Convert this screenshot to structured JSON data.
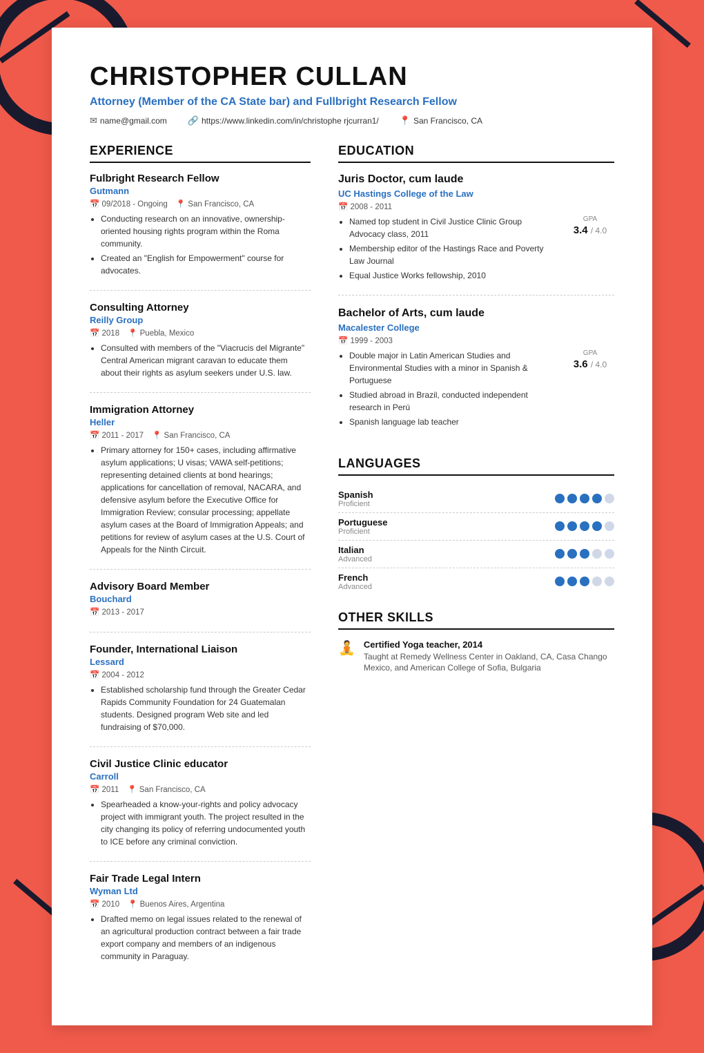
{
  "header": {
    "name": "CHRISTOPHER CULLAN",
    "title": "Attorney (Member of the CA State bar) and Fullbright Research Fellow",
    "contact": {
      "email": "name@gmail.com",
      "linkedin": "https://www.linkedin.com/in/christophe rjcurran1/",
      "location": "San Francisco, CA"
    }
  },
  "experience": {
    "section_title": "EXPERIENCE",
    "items": [
      {
        "title": "Fulbright Research Fellow",
        "company": "Gutmann",
        "date": "09/2018 - Ongoing",
        "location": "San Francisco, CA",
        "bullets": [
          "Conducting research on an innovative, ownership-oriented housing rights program within the Roma community.",
          "Created an \"English for Empowerment\" course for advocates."
        ]
      },
      {
        "title": "Consulting Attorney",
        "company": "Reilly Group",
        "date": "2018",
        "location": "Puebla, Mexico",
        "bullets": [
          "Consulted with members of the \"Viacrucis del Migrante\" Central American migrant caravan to educate them about their rights as asylum seekers under U.S. law."
        ]
      },
      {
        "title": "Immigration Attorney",
        "company": "Heller",
        "date": "2011 - 2017",
        "location": "San Francisco, CA",
        "bullets": [
          "Primary attorney for 150+ cases, including affirmative asylum applications; U visas; VAWA self-petitions; representing detained clients at bond hearings; applications for cancellation of removal, NACARA, and defensive asylum before the Executive Office for Immigration Review; consular processing; appellate asylum cases at the Board of Immigration Appeals; and petitions for review of asylum cases at the U.S. Court of Appeals for the Ninth Circuit."
        ]
      },
      {
        "title": "Advisory Board Member",
        "company": "Bouchard",
        "date": "2013 - 2017",
        "location": "",
        "bullets": []
      },
      {
        "title": "Founder, International Liaison",
        "company": "Lessard",
        "date": "2004 - 2012",
        "location": "",
        "bullets": [
          "Established scholarship fund through the Greater Cedar Rapids Community Foundation for 24 Guatemalan students. Designed program Web site and led fundraising of $70,000."
        ]
      },
      {
        "title": "Civil Justice Clinic educator",
        "company": "Carroll",
        "date": "2011",
        "location": "San Francisco, CA",
        "bullets": [
          "Spearheaded a know-your-rights and policy advocacy project with immigrant youth. The project resulted in the city changing its policy of referring undocumented youth to ICE before any criminal conviction."
        ]
      },
      {
        "title": "Fair Trade Legal Intern",
        "company": "Wyman Ltd",
        "date": "2010",
        "location": "Buenos Aires, Argentina",
        "bullets": [
          "Drafted memo on legal issues related to the renewal of an agricultural production contract between a fair trade export company and members of an indigenous community in Paraguay."
        ]
      }
    ]
  },
  "education": {
    "section_title": "EDUCATION",
    "items": [
      {
        "degree": "Juris Doctor, cum laude",
        "school": "UC Hastings College of the Law",
        "date": "2008 - 2011",
        "gpa": "3.4",
        "gpa_max": "4.0",
        "bullets": [
          "Named top student in Civil Justice Clinic Group Advocacy class, 2011",
          "Membership editor of the Hastings Race and Poverty Law Journal",
          "Equal Justice Works fellowship, 2010"
        ]
      },
      {
        "degree": "Bachelor of Arts, cum laude",
        "school": "Macalester College",
        "date": "1999 - 2003",
        "gpa": "3.6",
        "gpa_max": "4.0",
        "bullets": [
          "Double major in Latin American Studies and Environmental Studies with a minor in Spanish & Portuguese",
          "Studied abroad in Brazil, conducted independent research in Perú",
          "Spanish language lab teacher"
        ]
      }
    ]
  },
  "languages": {
    "section_title": "LANGUAGES",
    "items": [
      {
        "name": "Spanish",
        "level": "Proficient",
        "filled": 4,
        "total": 5
      },
      {
        "name": "Portuguese",
        "level": "Proficient",
        "filled": 4,
        "total": 5
      },
      {
        "name": "Italian",
        "level": "Advanced",
        "filled": 3,
        "total": 5
      },
      {
        "name": "French",
        "level": "Advanced",
        "filled": 3,
        "total": 5
      }
    ]
  },
  "other_skills": {
    "section_title": "OTHER SKILLS",
    "items": [
      {
        "icon": "🧘",
        "title": "Certified Yoga teacher, 2014",
        "description": "Taught at Remedy Wellness Center in Oakland, CA, Casa Chango Mexico, and American College of Sofia, Bulgaria"
      }
    ]
  }
}
